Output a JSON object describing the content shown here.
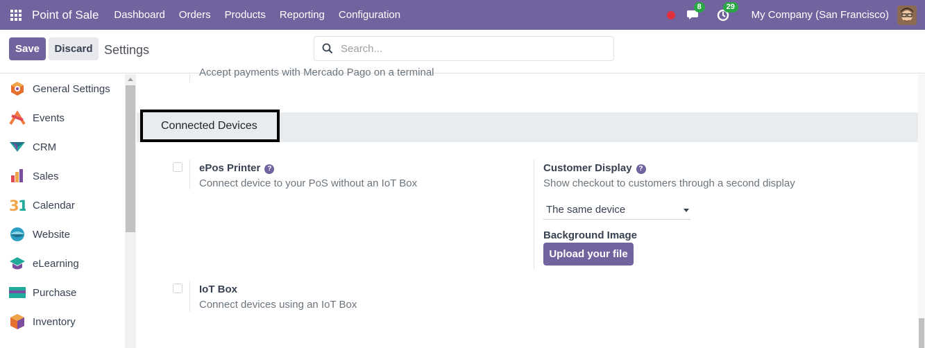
{
  "navbar": {
    "app_name": "Point of Sale",
    "menu": [
      "Dashboard",
      "Orders",
      "Products",
      "Reporting",
      "Configuration"
    ],
    "messages_count": "8",
    "activities_count": "29",
    "company": "My Company (San Francisco)",
    "bg_color": "#71639e"
  },
  "control": {
    "save_label": "Save",
    "discard_label": "Discard",
    "title": "Settings",
    "search_placeholder": "Search..."
  },
  "sidebar": {
    "items": [
      {
        "label": "General Settings",
        "icon": "general-settings-icon"
      },
      {
        "label": "Events",
        "icon": "events-icon"
      },
      {
        "label": "CRM",
        "icon": "crm-icon"
      },
      {
        "label": "Sales",
        "icon": "sales-icon"
      },
      {
        "label": "Calendar",
        "icon": "calendar-icon"
      },
      {
        "label": "Website",
        "icon": "website-icon"
      },
      {
        "label": "eLearning",
        "icon": "elearning-icon"
      },
      {
        "label": "Purchase",
        "icon": "purchase-icon"
      },
      {
        "label": "Inventory",
        "icon": "inventory-icon"
      }
    ]
  },
  "main": {
    "cut_text": "Accept payments with Mercado Pago on a terminal",
    "section_title": "Connected Devices",
    "epos": {
      "title": "ePos Printer",
      "description": "Connect device to your PoS without an IoT Box",
      "checked": false
    },
    "customer_display": {
      "title": "Customer Display",
      "description": "Show checkout to customers through a second display",
      "select_value": "The same device",
      "background_label": "Background Image",
      "upload_label": "Upload your file"
    },
    "iot": {
      "title": "IoT Box",
      "description": "Connect devices using an IoT Box",
      "checked": false
    }
  }
}
